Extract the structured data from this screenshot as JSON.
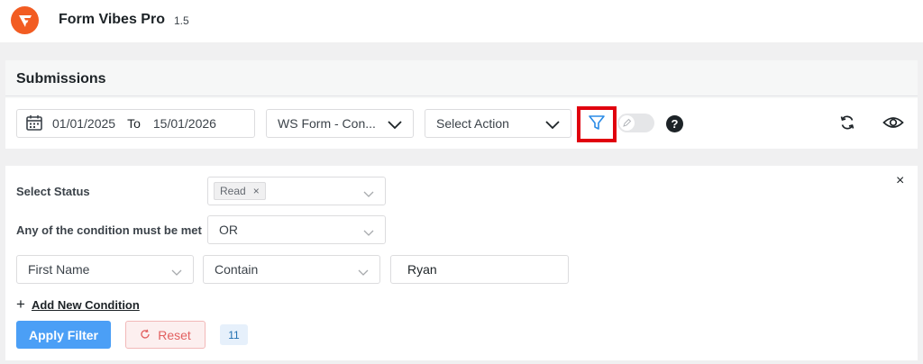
{
  "app": {
    "title": "Form Vibes Pro",
    "version": "1.5"
  },
  "submissions": {
    "title": "Submissions",
    "date_from": "01/01/2025",
    "date_sep": "To",
    "date_to": "15/01/2026",
    "form_select": "WS Form - Con...",
    "action_select": "Select Action",
    "help_label": "?"
  },
  "filter": {
    "close_label": "×",
    "status_label": "Select Status",
    "status_tag": "Read",
    "status_tag_remove": "×",
    "condition_label": "Any of the condition must be met",
    "condition_value": "OR",
    "field_value": "First Name",
    "operator_value": "Contain",
    "text_value": "Ryan",
    "add_plus": "+",
    "add_condition": "Add New Condition",
    "apply_label": "Apply Filter",
    "reset_label": "Reset",
    "count": "11"
  },
  "colors": {
    "brand": "#f25c22",
    "apply_button": "#4b9ff6",
    "highlight_border": "#e0000e",
    "filter_icon": "#2b8be6",
    "reset_text": "#e26060"
  },
  "icons": [
    "logo-icon",
    "calendar-icon",
    "chevron-down-icon",
    "filter-icon",
    "help-icon",
    "refresh-icon",
    "eye-icon",
    "close-icon",
    "reset-icon"
  ]
}
